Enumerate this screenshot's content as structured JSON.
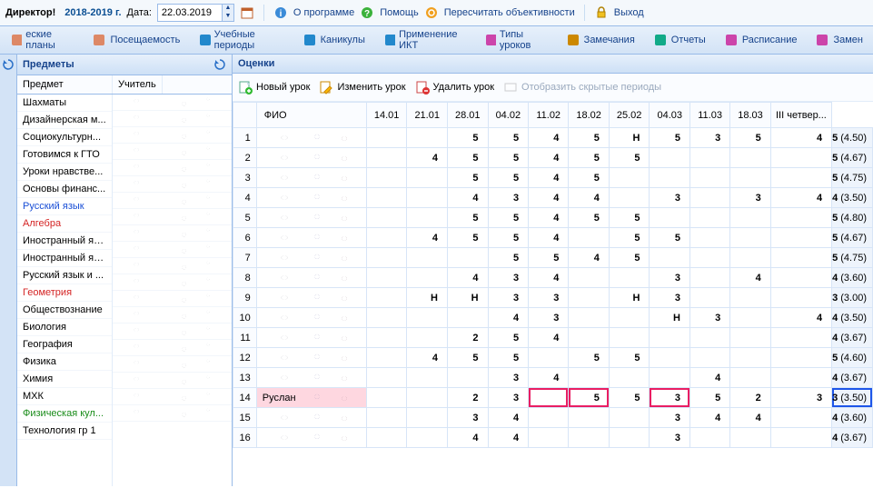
{
  "top": {
    "role": "Директор!",
    "period": "2018-2019 г.",
    "date_label": "Дата:",
    "date_value": "22.03.2019",
    "about": "О программе",
    "help": "Помощь",
    "recalc": "Пересчитать объективности",
    "exit": "Выход"
  },
  "toolbar": {
    "items": [
      "еские планы",
      "Посещаемость",
      "Учебные периоды",
      "Каникулы",
      "Применение ИКТ",
      "Типы уроков",
      "Замечания",
      "Отчеты",
      "Расписание",
      "Замен"
    ]
  },
  "subjects": {
    "title": "Предметы",
    "col1": "Предмет",
    "col2": "Учитель",
    "items": [
      {
        "label": "Шахматы"
      },
      {
        "label": "Дизайнерская м..."
      },
      {
        "label": "Социокультурн..."
      },
      {
        "label": "Готовимся к ГТО"
      },
      {
        "label": "Уроки нравстве..."
      },
      {
        "label": "Основы финанс..."
      },
      {
        "label": "Русский язык",
        "cls": "blue"
      },
      {
        "label": "Алгебра",
        "cls": "red"
      },
      {
        "label": "Иностранный яз..."
      },
      {
        "label": "Иностранный яз..."
      },
      {
        "label": "Русский язык и ..."
      },
      {
        "label": "Геометрия",
        "cls": "red"
      },
      {
        "label": "Обществознание"
      },
      {
        "label": "Биология"
      },
      {
        "label": "География"
      },
      {
        "label": "Физика"
      },
      {
        "label": "Химия"
      },
      {
        "label": "МХК"
      },
      {
        "label": "Физическая кул...",
        "cls": "green"
      },
      {
        "label": "Технология гр 1"
      }
    ]
  },
  "grades": {
    "title": "Оценки",
    "tb": {
      "new": "Новый урок",
      "edit": "Изменить урок",
      "del": "Удалить урок",
      "hidden": "Отобразить скрытые периоды"
    },
    "fio": "ФИО",
    "dates": [
      "14.01",
      "21.01",
      "28.01",
      "04.02",
      "11.02",
      "18.02",
      "25.02",
      "04.03",
      "11.03",
      "18.03"
    ],
    "summary_hdr": "III четвер...",
    "rows": [
      {
        "n": "1",
        "name": "",
        "c": [
          "",
          "",
          "5",
          "5",
          "4",
          "5",
          "Н",
          "5",
          "3",
          "5",
          "4"
        ],
        "s": "5 (4.50)"
      },
      {
        "n": "2",
        "name": "",
        "c": [
          "",
          "4",
          "5",
          "5",
          "4",
          "5",
          "5",
          "",
          "",
          "",
          ""
        ],
        "s": "5 (4.67)"
      },
      {
        "n": "3",
        "name": "",
        "c": [
          "",
          "",
          "5",
          "5",
          "4",
          "5",
          "",
          "",
          "",
          "",
          ""
        ],
        "s": "5 (4.75)"
      },
      {
        "n": "4",
        "name": "",
        "c": [
          "",
          "",
          "4",
          "3",
          "4",
          "4",
          "",
          "3",
          "",
          "3",
          "4"
        ],
        "s": "4 (3.50)"
      },
      {
        "n": "5",
        "name": "",
        "c": [
          "",
          "",
          "5",
          "5",
          "4",
          "5",
          "5",
          "",
          "",
          "",
          ""
        ],
        "s": "5 (4.80)"
      },
      {
        "n": "6",
        "name": "",
        "c": [
          "",
          "4",
          "5",
          "5",
          "4",
          "",
          "5",
          "5",
          "",
          "",
          ""
        ],
        "s": "5 (4.67)"
      },
      {
        "n": "7",
        "name": "",
        "c": [
          "",
          "",
          "",
          "5",
          "5",
          "4",
          "5",
          "",
          "",
          "",
          ""
        ],
        "s": "5 (4.75)"
      },
      {
        "n": "8",
        "name": "",
        "c": [
          "",
          "",
          "4",
          "3",
          "4",
          "",
          "",
          "3",
          "",
          "4",
          ""
        ],
        "s": "4 (3.60)"
      },
      {
        "n": "9",
        "name": "",
        "c": [
          "",
          "Н",
          "Н",
          "3",
          "3",
          "",
          "Н",
          "3",
          "",
          "",
          ""
        ],
        "s": "3 (3.00)"
      },
      {
        "n": "10",
        "name": "",
        "c": [
          "",
          "",
          "",
          "4",
          "3",
          "",
          "",
          "Н",
          "3",
          "",
          "4"
        ],
        "s": "4 (3.50)"
      },
      {
        "n": "11",
        "name": "",
        "c": [
          "",
          "",
          "2",
          "5",
          "4",
          "",
          "",
          "",
          "",
          "",
          ""
        ],
        "s": "4 (3.67)"
      },
      {
        "n": "12",
        "name": "",
        "c": [
          "",
          "4",
          "5",
          "5",
          "",
          "5",
          "5",
          "",
          "",
          "",
          ""
        ],
        "s": "5 (4.60)"
      },
      {
        "n": "13",
        "name": "",
        "c": [
          "",
          "",
          "",
          "3",
          "4",
          "",
          "",
          "",
          "4",
          "",
          ""
        ],
        "s": "4 (3.67)"
      },
      {
        "n": "14",
        "name": "Руслан",
        "c": [
          "",
          "",
          "2",
          "3",
          "",
          "5",
          "5",
          "3",
          "5",
          "2",
          "3"
        ],
        "s": "3 (3.50)",
        "sel": true,
        "hl": {
          "5": "red",
          "6": "red",
          "8": "red",
          "summary": "blue"
        }
      },
      {
        "n": "15",
        "name": "",
        "c": [
          "",
          "",
          "3",
          "4",
          "",
          "",
          "",
          "3",
          "4",
          "4",
          ""
        ],
        "s": "4 (3.60)"
      },
      {
        "n": "16",
        "name": "",
        "c": [
          "",
          "",
          "4",
          "4",
          "",
          "",
          "",
          "3",
          "",
          "",
          ""
        ],
        "s": "4 (3.67)"
      }
    ]
  }
}
